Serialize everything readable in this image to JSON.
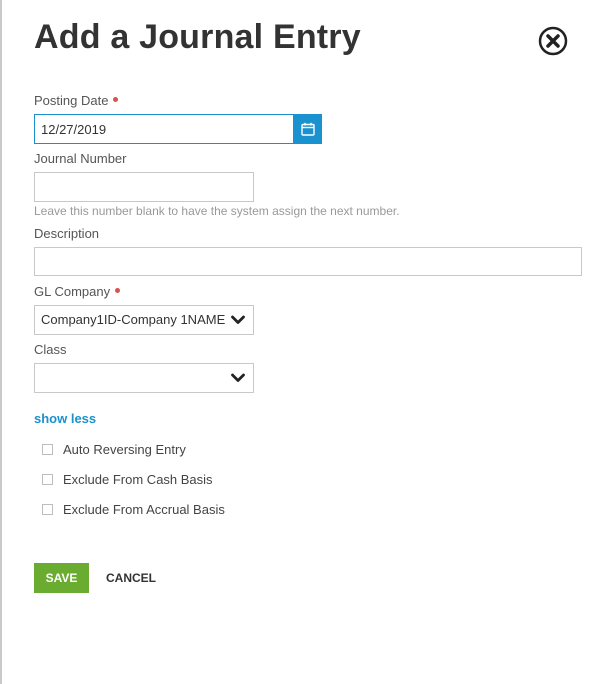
{
  "dialog": {
    "title": "Add a Journal Entry"
  },
  "fields": {
    "posting_date": {
      "label": "Posting Date",
      "value": "12/27/2019",
      "required": true
    },
    "journal_number": {
      "label": "Journal Number",
      "value": "",
      "hint": "Leave this number blank to have the system assign the next number."
    },
    "description": {
      "label": "Description",
      "value": ""
    },
    "gl_company": {
      "label": "GL Company",
      "selected": "Company1ID-Company 1NAME",
      "required": true
    },
    "class": {
      "label": "Class",
      "selected": ""
    }
  },
  "toggle": {
    "show_less_label": "show less"
  },
  "options": [
    {
      "label": "Auto Reversing Entry",
      "checked": false
    },
    {
      "label": "Exclude From Cash Basis",
      "checked": false
    },
    {
      "label": "Exclude From Accrual Basis",
      "checked": false
    }
  ],
  "actions": {
    "save_label": "SAVE",
    "cancel_label": "CANCEL"
  },
  "colors": {
    "accent_blue": "#1a92cf",
    "save_green": "#6aac2f",
    "required_red": "#d9534f"
  },
  "icons": {
    "close": "close-circle-icon",
    "calendar": "calendar-icon",
    "dropdown": "chevron-down-icon"
  }
}
